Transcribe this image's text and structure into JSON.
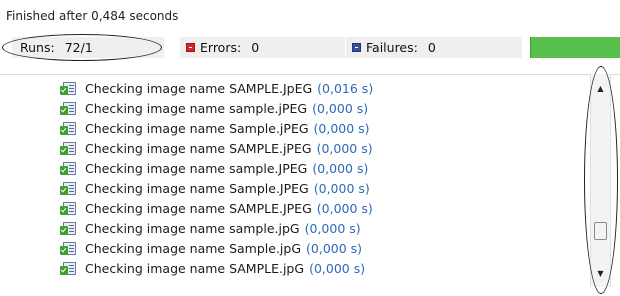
{
  "status": {
    "message": "Finished after 0,484 seconds"
  },
  "counters": {
    "runs_label": "Runs:",
    "runs_value": "72/1",
    "errors_label": "Errors:",
    "errors_value": "0",
    "failures_label": "Failures:",
    "failures_value": "0",
    "progress_fraction": 1.0,
    "progress_color": "#58c04d",
    "error_icon": "error-icon",
    "failure_icon": "failure-icon"
  },
  "tests": [
    {
      "name": "Checking image name SAMPLE.JpEG",
      "time": "(0,016 s)"
    },
    {
      "name": "Checking image name sample.jPEG",
      "time": "(0,000 s)"
    },
    {
      "name": "Checking image name Sample.jPEG",
      "time": "(0,000 s)"
    },
    {
      "name": "Checking image name SAMPLE.jPEG",
      "time": "(0,000 s)"
    },
    {
      "name": "Checking image name sample.JPEG",
      "time": "(0,000 s)"
    },
    {
      "name": "Checking image name Sample.JPEG",
      "time": "(0,000 s)"
    },
    {
      "name": "Checking image name SAMPLE.JPEG",
      "time": "(0,000 s)"
    },
    {
      "name": "Checking image name sample.jpG",
      "time": "(0,000 s)"
    },
    {
      "name": "Checking image name Sample.jpG",
      "time": "(0,000 s)"
    },
    {
      "name": "Checking image name SAMPLE.jpG",
      "time": "(0,000 s)"
    }
  ],
  "test_icon": "passed-test-icon",
  "time_color": "#2b6bb8"
}
